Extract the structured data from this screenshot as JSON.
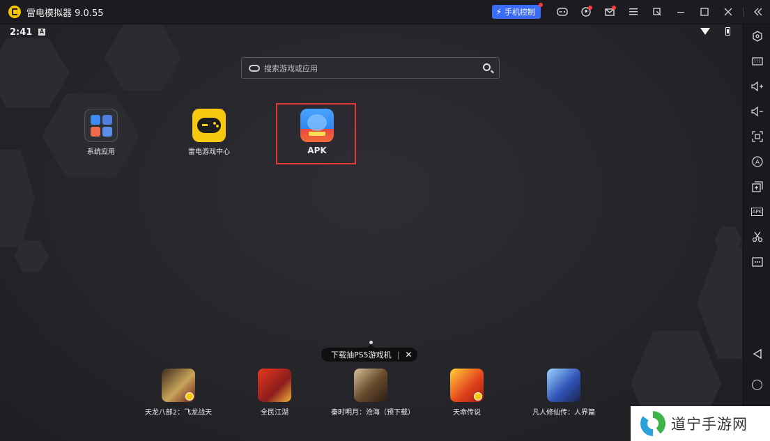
{
  "titlebar": {
    "app_title": "雷电模拟器 9.0.55",
    "phone_control_label": "手机控制",
    "icons": [
      "gamepad-icon",
      "user-icon",
      "mail-icon",
      "menu-icon",
      "restore-icon",
      "minimize-icon",
      "maximize-icon",
      "close-icon",
      "collapse-icon"
    ]
  },
  "statusbar": {
    "time": "2:41",
    "a_badge": "A"
  },
  "search": {
    "placeholder": "搜索游戏或应用"
  },
  "apps": [
    {
      "label": "系统应用"
    },
    {
      "label": "雷电游戏中心"
    },
    {
      "label": "APK"
    }
  ],
  "promo": {
    "tooltip_text": "下载抽PS5游戏机 ",
    "close": "✕"
  },
  "games": [
    {
      "label": "天龙八部2：飞龙战天"
    },
    {
      "label": "全民江湖"
    },
    {
      "label": "秦时明月：沧海（预下载）"
    },
    {
      "label": "天命传说"
    },
    {
      "label": "凡人修仙传：人界篇"
    }
  ],
  "toolbar": {
    "items": [
      "settings",
      "keyboard",
      "volume-up",
      "volume-down",
      "screenshot",
      "auto-operation",
      "multi-instance",
      "install-apk",
      "scissors",
      "more",
      "back",
      "home"
    ]
  },
  "watermark": {
    "text": "道宁手游网"
  },
  "colors": {
    "accent": "#3b6cf6",
    "highlight": "#e53935",
    "brand_yellow": "#f6c90e"
  }
}
